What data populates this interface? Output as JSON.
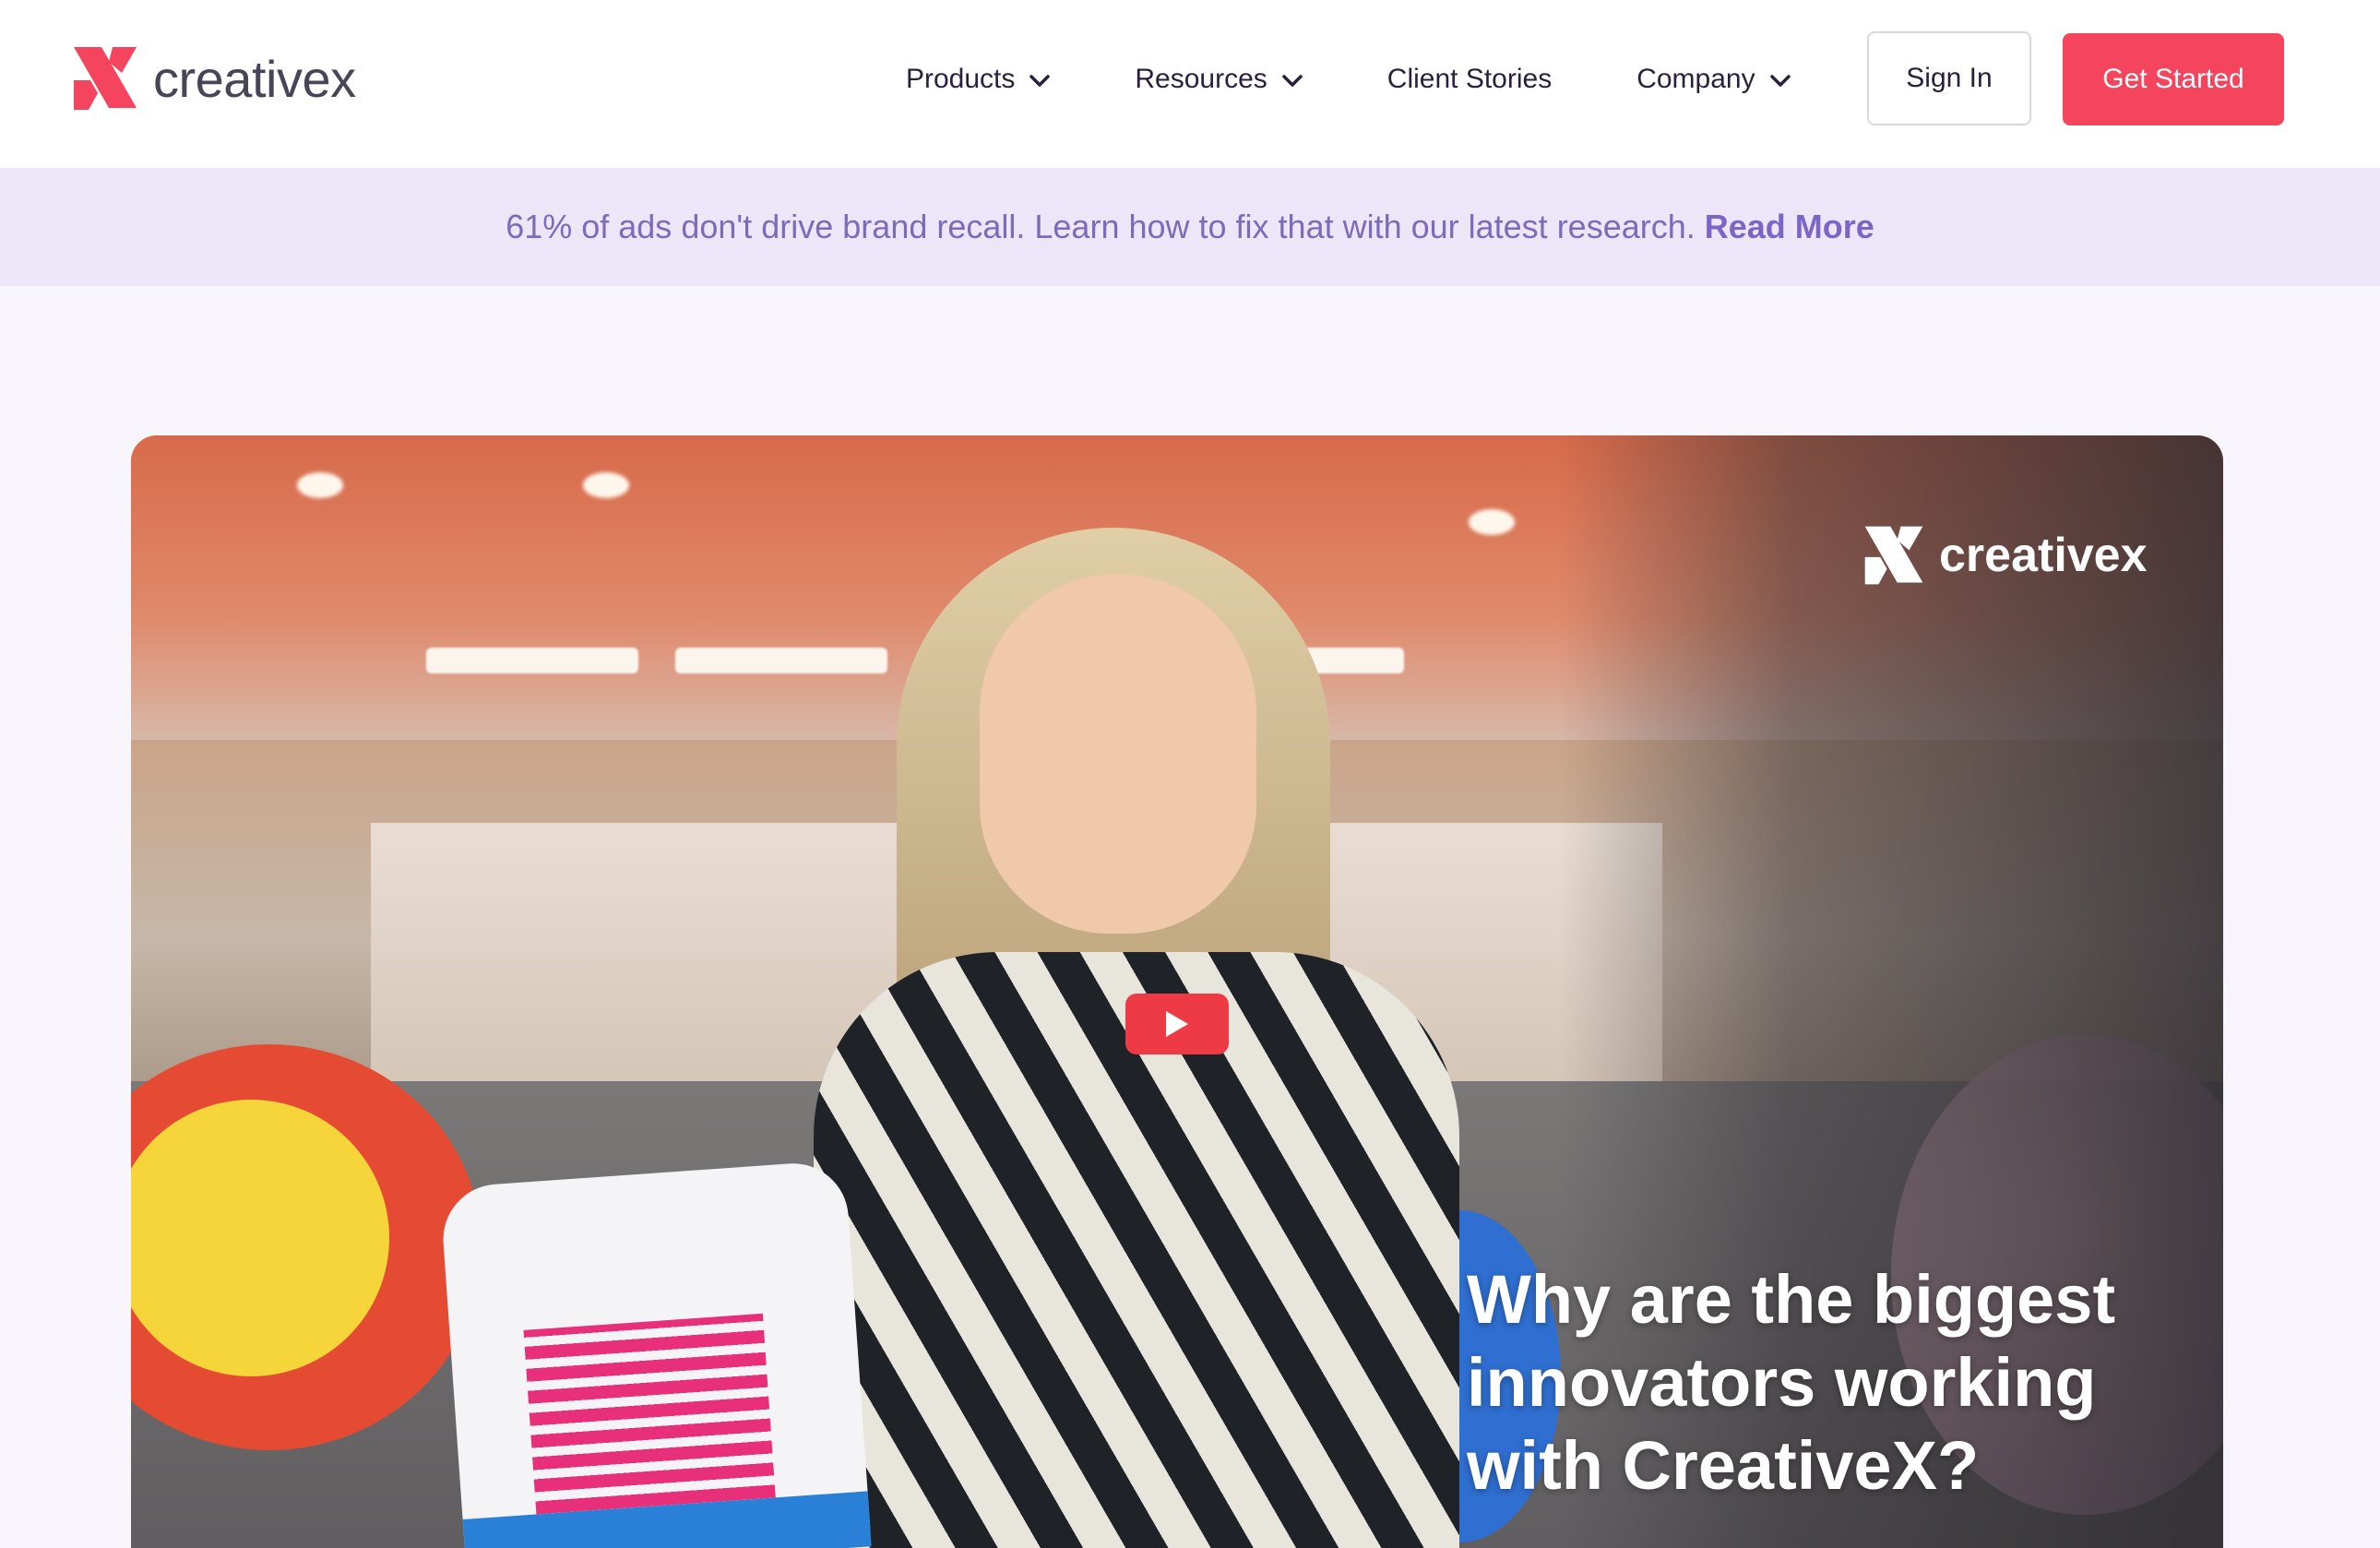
{
  "header": {
    "logo_text": "creativex",
    "nav": [
      {
        "label": "Products",
        "has_dropdown": true
      },
      {
        "label": "Resources",
        "has_dropdown": true
      },
      {
        "label": "Client Stories",
        "has_dropdown": false
      },
      {
        "label": "Company",
        "has_dropdown": true
      }
    ],
    "sign_in_label": "Sign In",
    "get_started_label": "Get Started"
  },
  "banner": {
    "text": "61% of ads don't drive brand recall. Learn how to fix that with our latest research.",
    "link_label": "Read More"
  },
  "video": {
    "logo_text": "creativex",
    "headline_lines": [
      "Why are the biggest",
      "innovators working",
      "with CreativeX?"
    ],
    "play_icon": "play-icon"
  },
  "colors": {
    "brand": "#f5445d",
    "banner_bg": "#ede6f8",
    "banner_text": "#7c6bb9",
    "nav_text": "#2a1f3d"
  }
}
